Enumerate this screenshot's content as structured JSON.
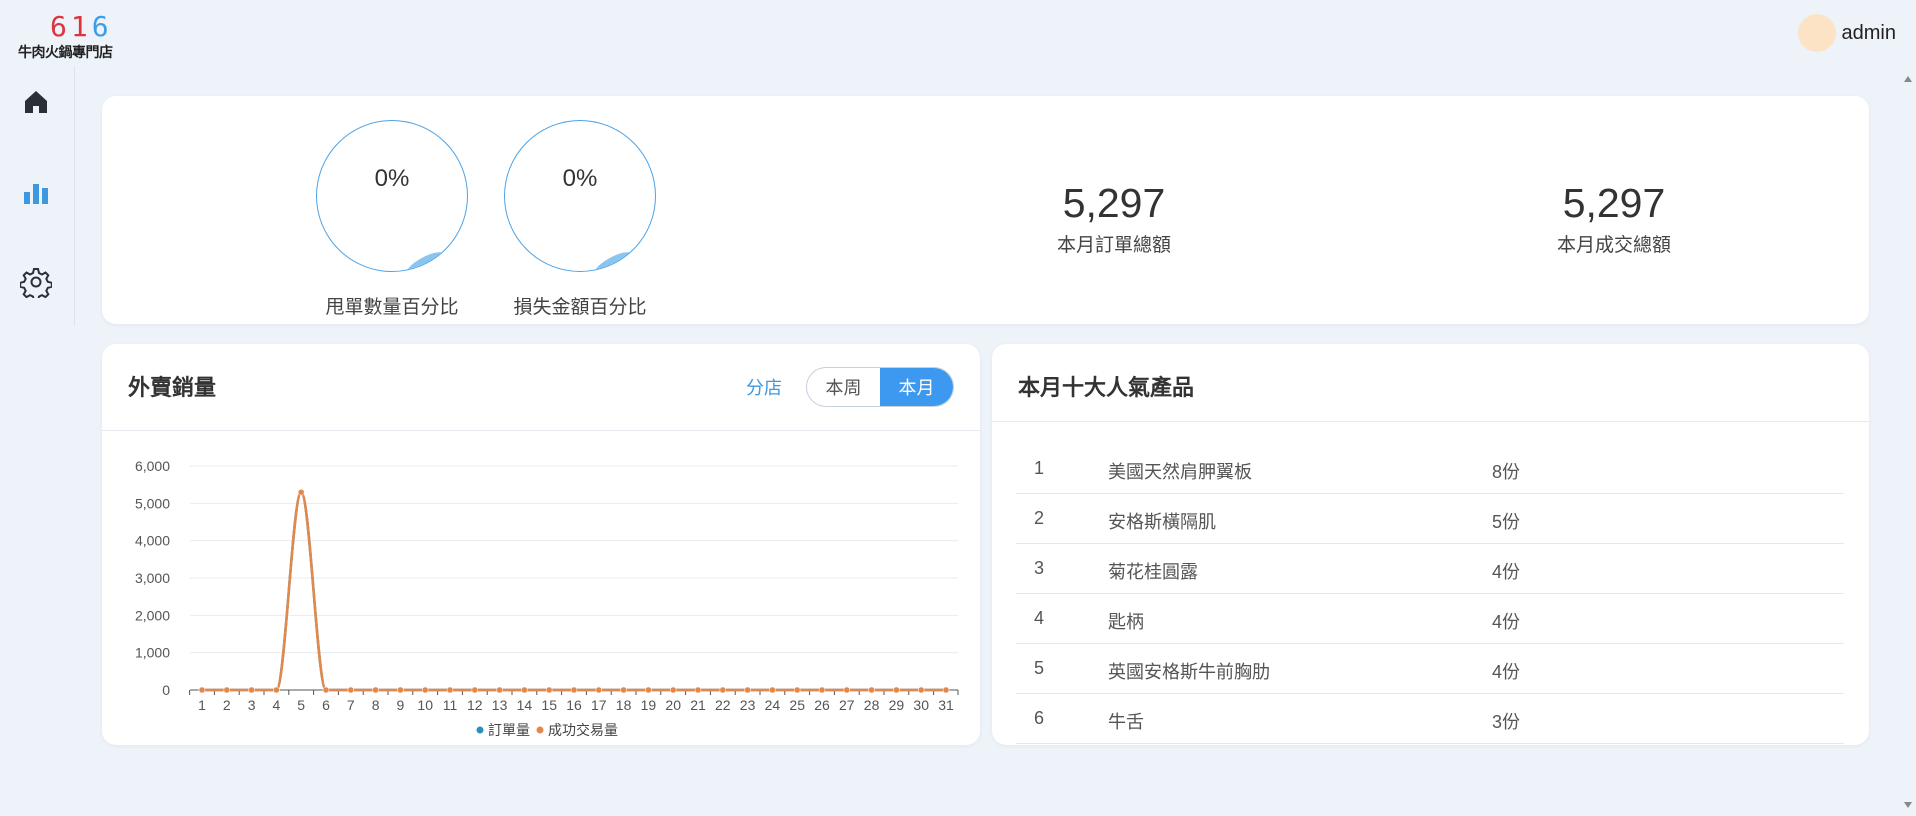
{
  "logo": {
    "number": "616",
    "text": "牛肉火鍋專門店"
  },
  "user": {
    "name": "admin"
  },
  "sidebar": {
    "items": [
      {
        "icon": "home-icon"
      },
      {
        "icon": "bar-chart-icon"
      },
      {
        "icon": "gear-icon"
      }
    ]
  },
  "stats": {
    "gauges": [
      {
        "value": "0%",
        "label": "甩單數量百分比"
      },
      {
        "value": "0%",
        "label": "損失金額百分比"
      }
    ],
    "totals": [
      {
        "value": "5,297",
        "label": "本月訂單總額"
      },
      {
        "value": "5,297",
        "label": "本月成交總額"
      }
    ]
  },
  "sales": {
    "title": "外賣銷量",
    "branch_link": "分店",
    "toggle": {
      "week": "本周",
      "month": "本月",
      "active": "month"
    }
  },
  "chart_data": {
    "type": "line",
    "x": [
      "1",
      "2",
      "3",
      "4",
      "5",
      "6",
      "7",
      "8",
      "9",
      "10",
      "11",
      "12",
      "13",
      "14",
      "15",
      "16",
      "17",
      "18",
      "19",
      "20",
      "21",
      "22",
      "23",
      "24",
      "25",
      "26",
      "27",
      "28",
      "29",
      "30",
      "31"
    ],
    "ylim": [
      0,
      6000
    ],
    "yticks": [
      "0",
      "1,000",
      "2,000",
      "3,000",
      "4,000",
      "5,000",
      "6,000"
    ],
    "ytick_values": [
      0,
      1000,
      2000,
      3000,
      4000,
      5000,
      6000
    ],
    "grid": true,
    "legend": "bottom-center",
    "series": [
      {
        "name": "訂單量",
        "color": "#2a8fbd",
        "values": [
          0,
          0,
          0,
          0,
          5297,
          0,
          0,
          0,
          0,
          0,
          0,
          0,
          0,
          0,
          0,
          0,
          0,
          0,
          0,
          0,
          0,
          0,
          0,
          0,
          0,
          0,
          0,
          0,
          0,
          0,
          0
        ]
      },
      {
        "name": "成功交易量",
        "color": "#e3884a",
        "values": [
          0,
          0,
          0,
          0,
          5297,
          0,
          0,
          0,
          0,
          0,
          0,
          0,
          0,
          0,
          0,
          0,
          0,
          0,
          0,
          0,
          0,
          0,
          0,
          0,
          0,
          0,
          0,
          0,
          0,
          0,
          0
        ]
      }
    ]
  },
  "top10": {
    "title": "本月十大人氣產品",
    "items": [
      {
        "rank": "1",
        "name": "美國天然肩胛翼板",
        "qty": "8份"
      },
      {
        "rank": "2",
        "name": "安格斯橫隔肌",
        "qty": "5份"
      },
      {
        "rank": "3",
        "name": "菊花桂圓露",
        "qty": "4份"
      },
      {
        "rank": "4",
        "name": "匙柄",
        "qty": "4份"
      },
      {
        "rank": "5",
        "name": "英國安格斯牛前胸肋",
        "qty": "4份"
      },
      {
        "rank": "6",
        "name": "牛舌",
        "qty": "3份"
      }
    ]
  },
  "colors": {
    "accent": "#3d98f0",
    "background": "#eef2f9",
    "gauge": "#4ea3e6"
  }
}
